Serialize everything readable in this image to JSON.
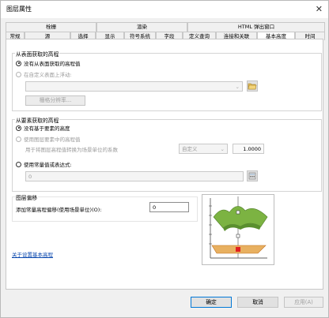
{
  "window": {
    "title": "图层属性",
    "close_glyph": "✕"
  },
  "tabs_row1": [
    "栓栅",
    "渲染",
    "HTML 弹出窗口"
  ],
  "tabs_row2": [
    "常规",
    "源",
    "选择",
    "显示",
    "符号系统",
    "字段",
    "定义查询",
    "连接和关联",
    "基本高度",
    "时间"
  ],
  "active_tab": "基本高度",
  "surface_group": {
    "title": "从表面获取的高程",
    "opt_none": "没有从表面获取的高程值",
    "opt_custom": "在自定义表面上浮动:",
    "resolution_button": "栅格分辨率..."
  },
  "feature_group": {
    "title": "从要素获取的高程",
    "opt_none": "没有基于要素的高度",
    "opt_use_values": "使用图层要素中的高程值",
    "factor_label": "用于将图层高程值转换为场景单位的系数",
    "unit_select": "自定义",
    "factor_value": "1.0000",
    "opt_expression": "使用常量值或表达式:",
    "expression_value": "0"
  },
  "offset_group": {
    "title": "图层偏移",
    "label": "添加常量高程偏移(使用场景单位)(O):",
    "value": "0"
  },
  "link_text": "关于设置基本高程",
  "buttons": {
    "ok": "确定",
    "cancel": "取消",
    "apply": "应用(A)"
  },
  "colors": {
    "accent": "#0078d7",
    "link": "#0645ad"
  }
}
